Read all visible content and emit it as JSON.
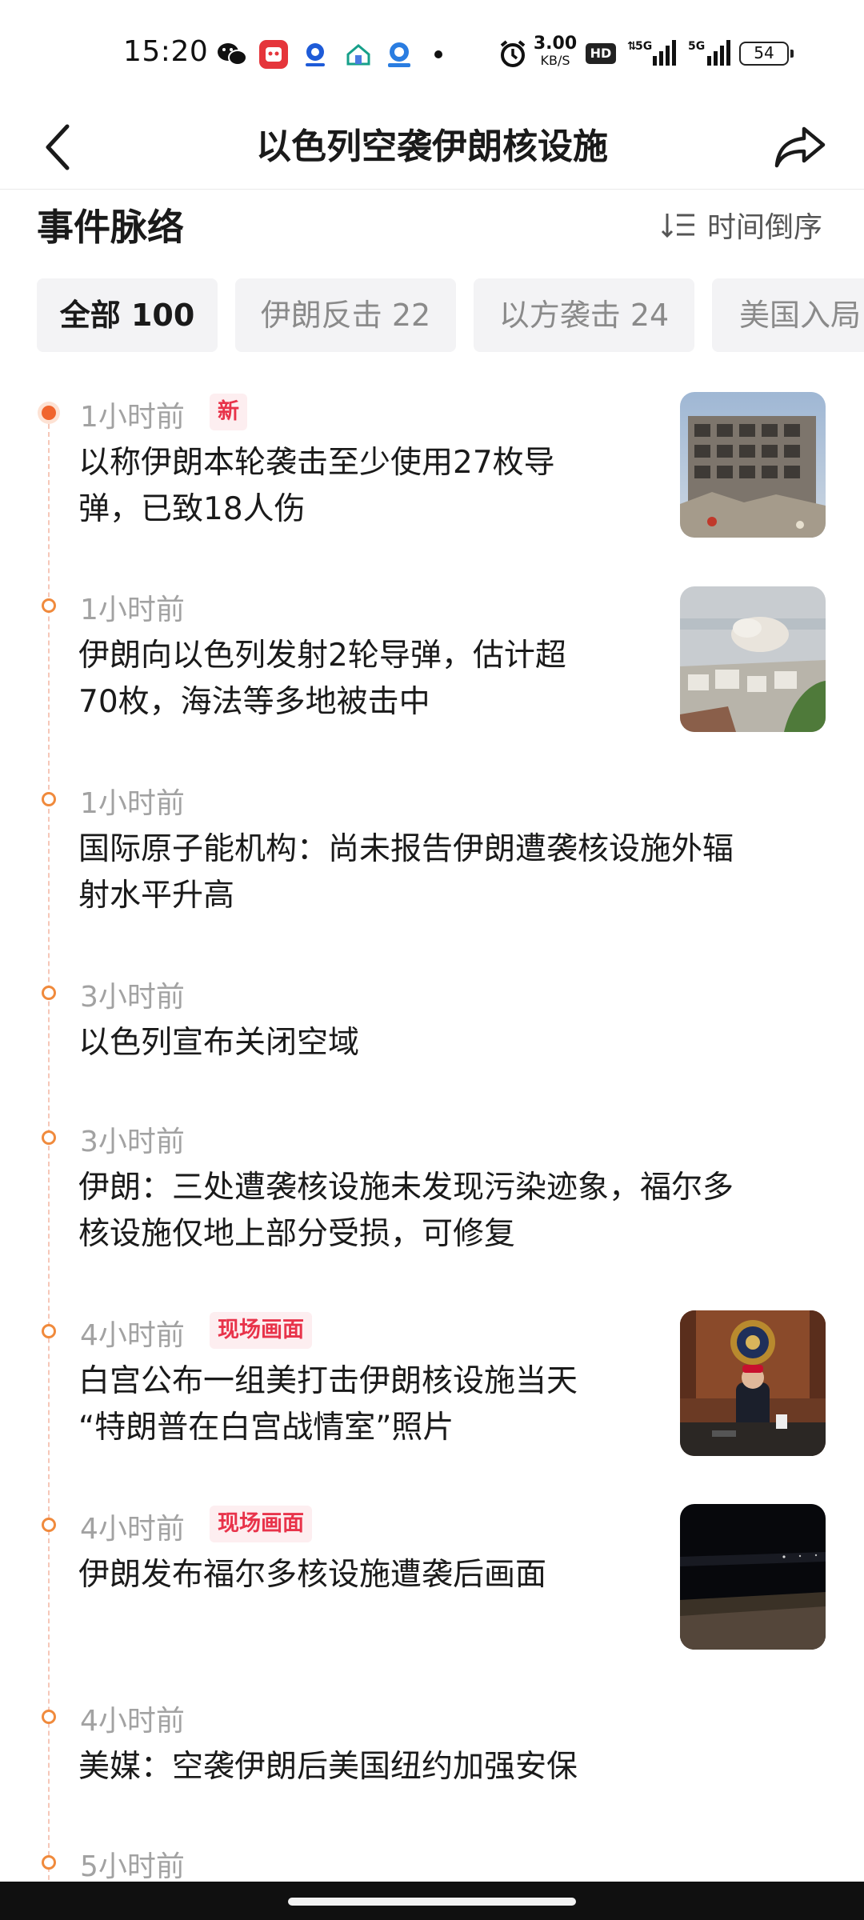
{
  "status_bar": {
    "time": "15:20",
    "net_speed_value": "3.00",
    "net_speed_unit": "KB/S",
    "hd_badge": "HD",
    "signal_1": "5G",
    "signal_2": "5G",
    "battery": "54",
    "app_icons": [
      "wechat-icon",
      "pinduoduo-icon",
      "app-blue-icon",
      "smart-home-icon",
      "app-blue2-icon"
    ]
  },
  "header": {
    "title": "以色列空袭伊朗核设施"
  },
  "section": {
    "title": "事件脉络",
    "sort_label": "时间倒序"
  },
  "tabs": [
    {
      "label": "全部 100",
      "active": true
    },
    {
      "label": "伊朗反击 22",
      "active": false
    },
    {
      "label": "以方袭击 24",
      "active": false
    },
    {
      "label": "美国入局",
      "active": false
    }
  ],
  "timeline": [
    {
      "time": "1小时前",
      "tag": "新",
      "line1": "以称伊朗本轮袭击至少使用27枚导",
      "line2": "弹，已致18人伤",
      "has_image": true
    },
    {
      "time": "1小时前",
      "tag": "",
      "line1": "伊朗向以色列发射2轮导弹，估计超",
      "line2": "70枚，海法等多地被击中",
      "has_image": true
    },
    {
      "time": "1小时前",
      "tag": "",
      "line1": "国际原子能机构：尚未报告伊朗遭袭核设施外辐",
      "line2": "射水平升高",
      "has_image": false
    },
    {
      "time": "3小时前",
      "tag": "",
      "line1": "以色列宣布关闭空域",
      "line2": "",
      "has_image": false
    },
    {
      "time": "3小时前",
      "tag": "",
      "line1": "伊朗：三处遭袭核设施未发现污染迹象，福尔多",
      "line2": "核设施仅地上部分受损，可修复",
      "has_image": false
    },
    {
      "time": "4小时前",
      "tag": "现场画面",
      "line1": "白宫公布一组美打击伊朗核设施当天",
      "line2": "“特朗普在白宫战情室”照片",
      "has_image": true
    },
    {
      "time": "4小时前",
      "tag": "现场画面",
      "line1": "伊朗发布福尔多核设施遭袭后画面",
      "line2": "",
      "has_image": true
    },
    {
      "time": "4小时前",
      "tag": "",
      "line1": "美媒：空袭伊朗后美国纽约加强安保",
      "line2": "",
      "has_image": false
    },
    {
      "time": "5小时前",
      "tag": "",
      "line1": "",
      "line2": "",
      "has_image": false
    }
  ],
  "colors": {
    "accent_orange": "#f0652e",
    "tag_red": "#e8334a",
    "tag_bg": "#fdeef0",
    "tab_bg": "#f3f3f5"
  }
}
